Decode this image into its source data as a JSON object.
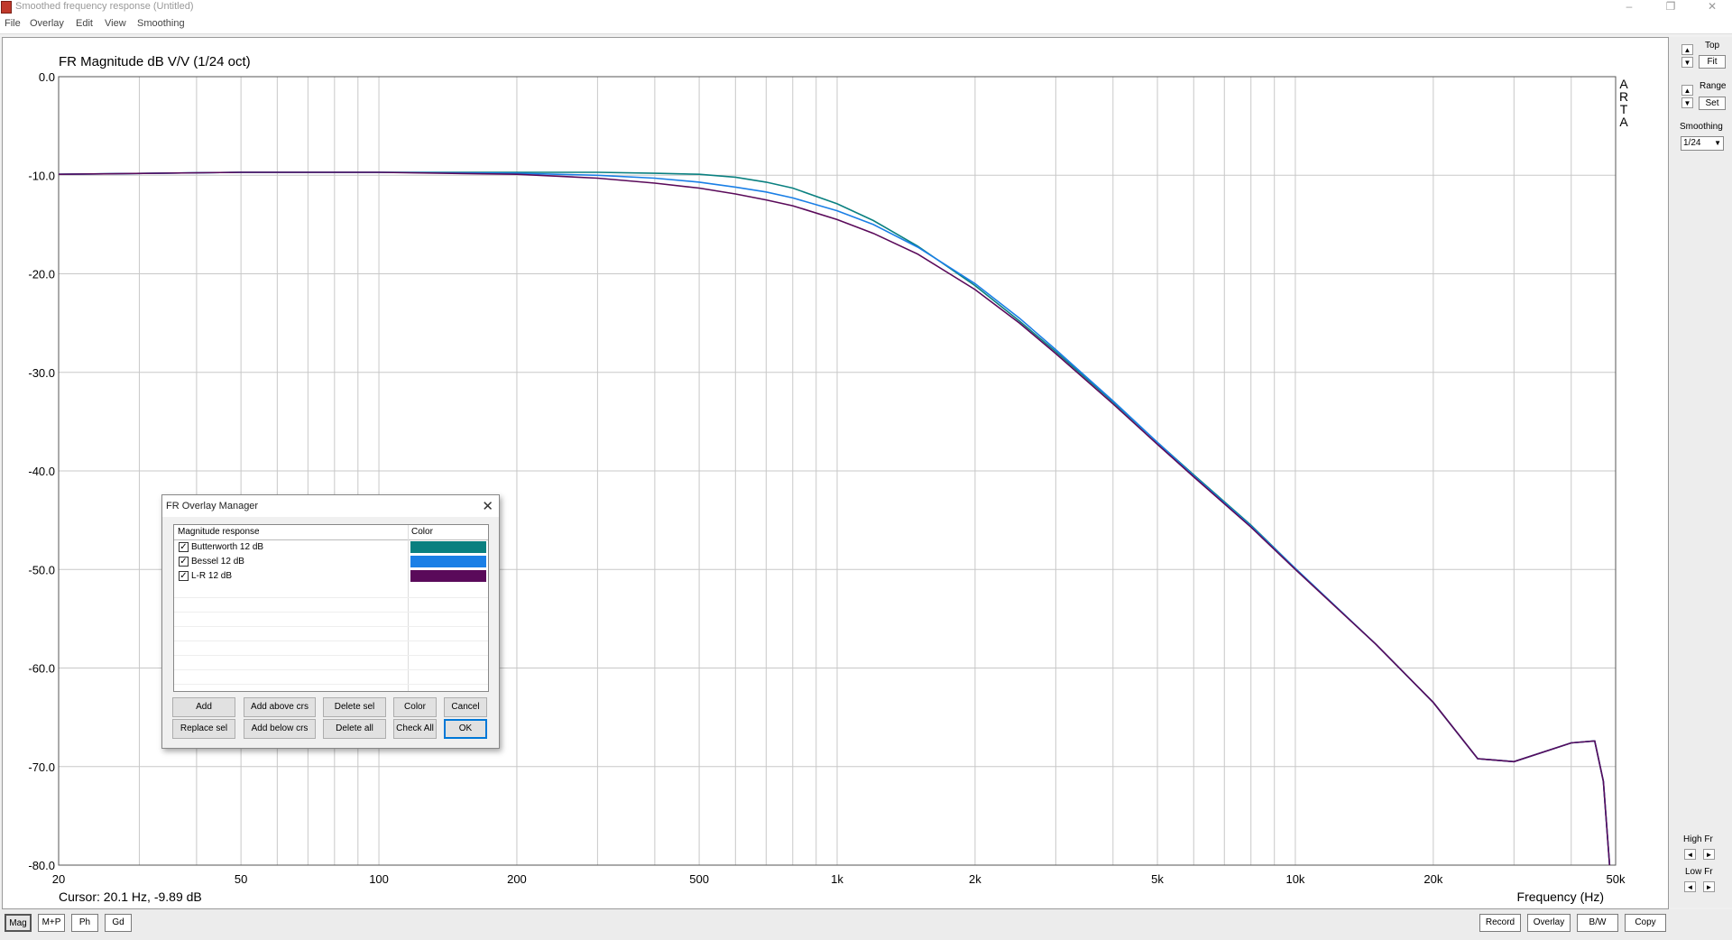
{
  "window": {
    "title": "Smoothed frequency response (Untitled)",
    "min": "–",
    "restore": "❐",
    "close": "✕"
  },
  "menu": [
    "File",
    "Overlay",
    "Edit",
    "View",
    "Smoothing"
  ],
  "chart_data": {
    "type": "line",
    "title": "FR Magnitude dB V/V (1/24 oct)",
    "xlabel": "Frequency (Hz)",
    "ylabel": "",
    "xscale": "log",
    "xlim": [
      20,
      50000
    ],
    "ylim": [
      -80,
      0
    ],
    "grid": true,
    "y_ticks": [
      "0.0",
      "-10.0",
      "-20.0",
      "-30.0",
      "-40.0",
      "-50.0",
      "-60.0",
      "-70.0",
      "-80.0"
    ],
    "x_ticks": [
      {
        "v": 20,
        "label": "20"
      },
      {
        "v": 50,
        "label": "50"
      },
      {
        "v": 100,
        "label": "100"
      },
      {
        "v": 200,
        "label": "200"
      },
      {
        "v": 500,
        "label": "500"
      },
      {
        "v": 1000,
        "label": "1k"
      },
      {
        "v": 2000,
        "label": "2k"
      },
      {
        "v": 5000,
        "label": "5k"
      },
      {
        "v": 10000,
        "label": "10k"
      },
      {
        "v": 20000,
        "label": "20k"
      },
      {
        "v": 50000,
        "label": "50k"
      }
    ],
    "cursor_text": "Cursor: 20.1 Hz, -9.89 dB",
    "watermark": "ARTA",
    "series": [
      {
        "name": "Butterworth 12 dB",
        "color": "#0a8080",
        "x": [
          20,
          50,
          100,
          200,
          300,
          400,
          500,
          600,
          700,
          800,
          1000,
          1200,
          1500,
          2000,
          2500,
          3000,
          4000,
          5000,
          6000,
          8000,
          10000,
          15000,
          20000,
          25000,
          30000,
          40000,
          45000,
          47000,
          48500
        ],
        "y": [
          -9.9,
          -9.7,
          -9.7,
          -9.7,
          -9.7,
          -9.8,
          -9.9,
          -10.2,
          -10.7,
          -11.3,
          -12.9,
          -14.6,
          -17.2,
          -21.2,
          -24.8,
          -27.9,
          -33.0,
          -37.1,
          -40.4,
          -45.5,
          -49.9,
          -57.6,
          -63.5,
          -69.2,
          -69.5,
          -67.6,
          -67.4,
          -71.5,
          -80.0
        ]
      },
      {
        "name": "Bessel 12 dB",
        "color": "#1a7fe6",
        "x": [
          20,
          50,
          100,
          200,
          300,
          400,
          500,
          600,
          700,
          800,
          1000,
          1200,
          1500,
          2000,
          2500,
          3000,
          4000,
          5000,
          6000,
          8000,
          10000,
          15000,
          20000,
          25000,
          30000,
          40000,
          45000,
          47000,
          48500
        ],
        "y": [
          -9.9,
          -9.7,
          -9.7,
          -9.8,
          -10.0,
          -10.3,
          -10.7,
          -11.2,
          -11.7,
          -12.3,
          -13.6,
          -15.0,
          -17.3,
          -21.0,
          -24.5,
          -27.7,
          -32.9,
          -37.1,
          -40.5,
          -45.6,
          -49.9,
          -57.6,
          -63.5,
          -69.2,
          -69.5,
          -67.6,
          -67.4,
          -71.5,
          -80.0
        ]
      },
      {
        "name": "L-R 12 dB",
        "color": "#5a0a5a",
        "x": [
          20,
          50,
          100,
          200,
          300,
          400,
          500,
          600,
          700,
          800,
          1000,
          1200,
          1500,
          2000,
          2500,
          3000,
          4000,
          5000,
          6000,
          8000,
          10000,
          15000,
          20000,
          25000,
          30000,
          40000,
          45000,
          47000,
          48500
        ],
        "y": [
          -9.9,
          -9.7,
          -9.7,
          -9.9,
          -10.3,
          -10.8,
          -11.3,
          -11.9,
          -12.5,
          -13.1,
          -14.5,
          -15.9,
          -18.0,
          -21.6,
          -25.0,
          -28.1,
          -33.2,
          -37.3,
          -40.6,
          -45.7,
          -50.0,
          -57.6,
          -63.5,
          -69.2,
          -69.5,
          -67.6,
          -67.4,
          -71.5,
          -80.0
        ]
      }
    ]
  },
  "right_panel": {
    "top_label": "Top",
    "fit": "Fit",
    "range_label": "Range",
    "set": "Set",
    "smoothing_label": "Smoothing",
    "smoothing_value": "1/24",
    "high_fr": "High Fr",
    "low_fr": "Low Fr",
    "up": "▲",
    "down": "▼",
    "left": "◄",
    "right": "►"
  },
  "bottom_tabs": [
    "Mag",
    "M+P",
    "Ph",
    "Gd"
  ],
  "bottom_buttons": [
    "Record",
    "Overlay",
    "B/W",
    "Copy"
  ],
  "dialog": {
    "title": "FR Overlay Manager",
    "close": "✕",
    "col_response": "Magnitude response",
    "col_color": "Color",
    "rows": [
      {
        "label": "Butterworth 12 dB",
        "checked": "✓",
        "color": "#0a8080"
      },
      {
        "label": "Bessel 12 dB",
        "checked": "✓",
        "color": "#1a7fe6"
      },
      {
        "label": "L-R 12 dB",
        "checked": "✓",
        "color": "#5a0a5a"
      }
    ],
    "buttons_row1": [
      "Add",
      "Add above crs",
      "Delete sel",
      "Color",
      "Cancel"
    ],
    "buttons_row2": [
      "Replace sel",
      "Add below crs",
      "Delete all",
      "Check All",
      "OK"
    ]
  }
}
